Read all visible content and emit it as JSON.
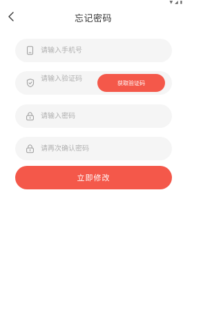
{
  "header": {
    "title": "忘记密码"
  },
  "form": {
    "phone_placeholder": "请输入手机号",
    "code_placeholder": "请输入验证码",
    "get_code_label": "获取验证码",
    "password_placeholder": "请输入密码",
    "confirm_placeholder": "请再次确认密码"
  },
  "submit_label": "立即修改",
  "icons": {
    "back": "chevron-left-icon",
    "phone": "phone-icon",
    "shield": "shield-check-icon",
    "lock": "lock-icon"
  },
  "colors": {
    "accent": "#f4584a",
    "field_bg": "#f5f5f5",
    "placeholder": "#b0b0b0"
  }
}
